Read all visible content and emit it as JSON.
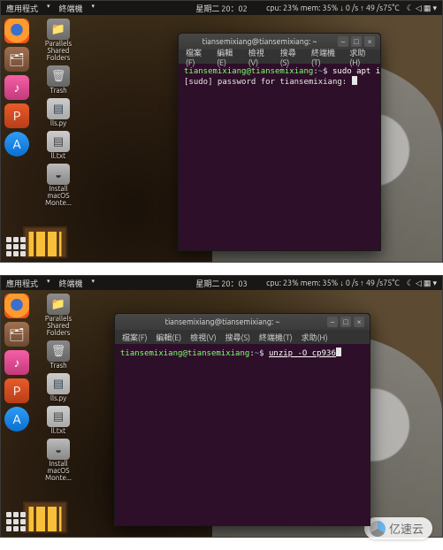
{
  "topbar": {
    "app_menu": "應用程式",
    "terminal_menu": "終端機",
    "datetime": "星期二 20：02",
    "datetime2": "星期二 20：03",
    "stats": "cpu: 23% mem: 35% ↓  0  /s ↑  49  /s75°C",
    "sys_icons": "☾  ◁ ▦ ▾"
  },
  "dock": {
    "firefox": "firefox",
    "files": "files",
    "music": "music",
    "doc": "presentation",
    "store": "software-store"
  },
  "desktop": {
    "parallels": "Parallels\nShared\nFolders",
    "trash": "Trash",
    "py": "lls.py",
    "txt": "ll.txt",
    "install": "Install\nmacOS\nMonte..."
  },
  "terminal": {
    "title": "tiansemixiang@tiansemixiang: ~",
    "menu": {
      "file": "檔案(F)",
      "edit": "編輯(E)",
      "view": "檢視(V)",
      "search": "搜尋(S)",
      "terminal": "終端機(T)",
      "help": "求助(H)"
    },
    "prompt_user": "tiansemixiang@tiansemixiang",
    "prompt_sep": ":",
    "prompt_path": "~",
    "prompt_end": "$",
    "cmd1": "sudo apt install unzip zip",
    "line2": "[sudo] password for tiansemixiang:",
    "cmd2": "unzip -O cp936"
  },
  "watermark": "亿速云"
}
